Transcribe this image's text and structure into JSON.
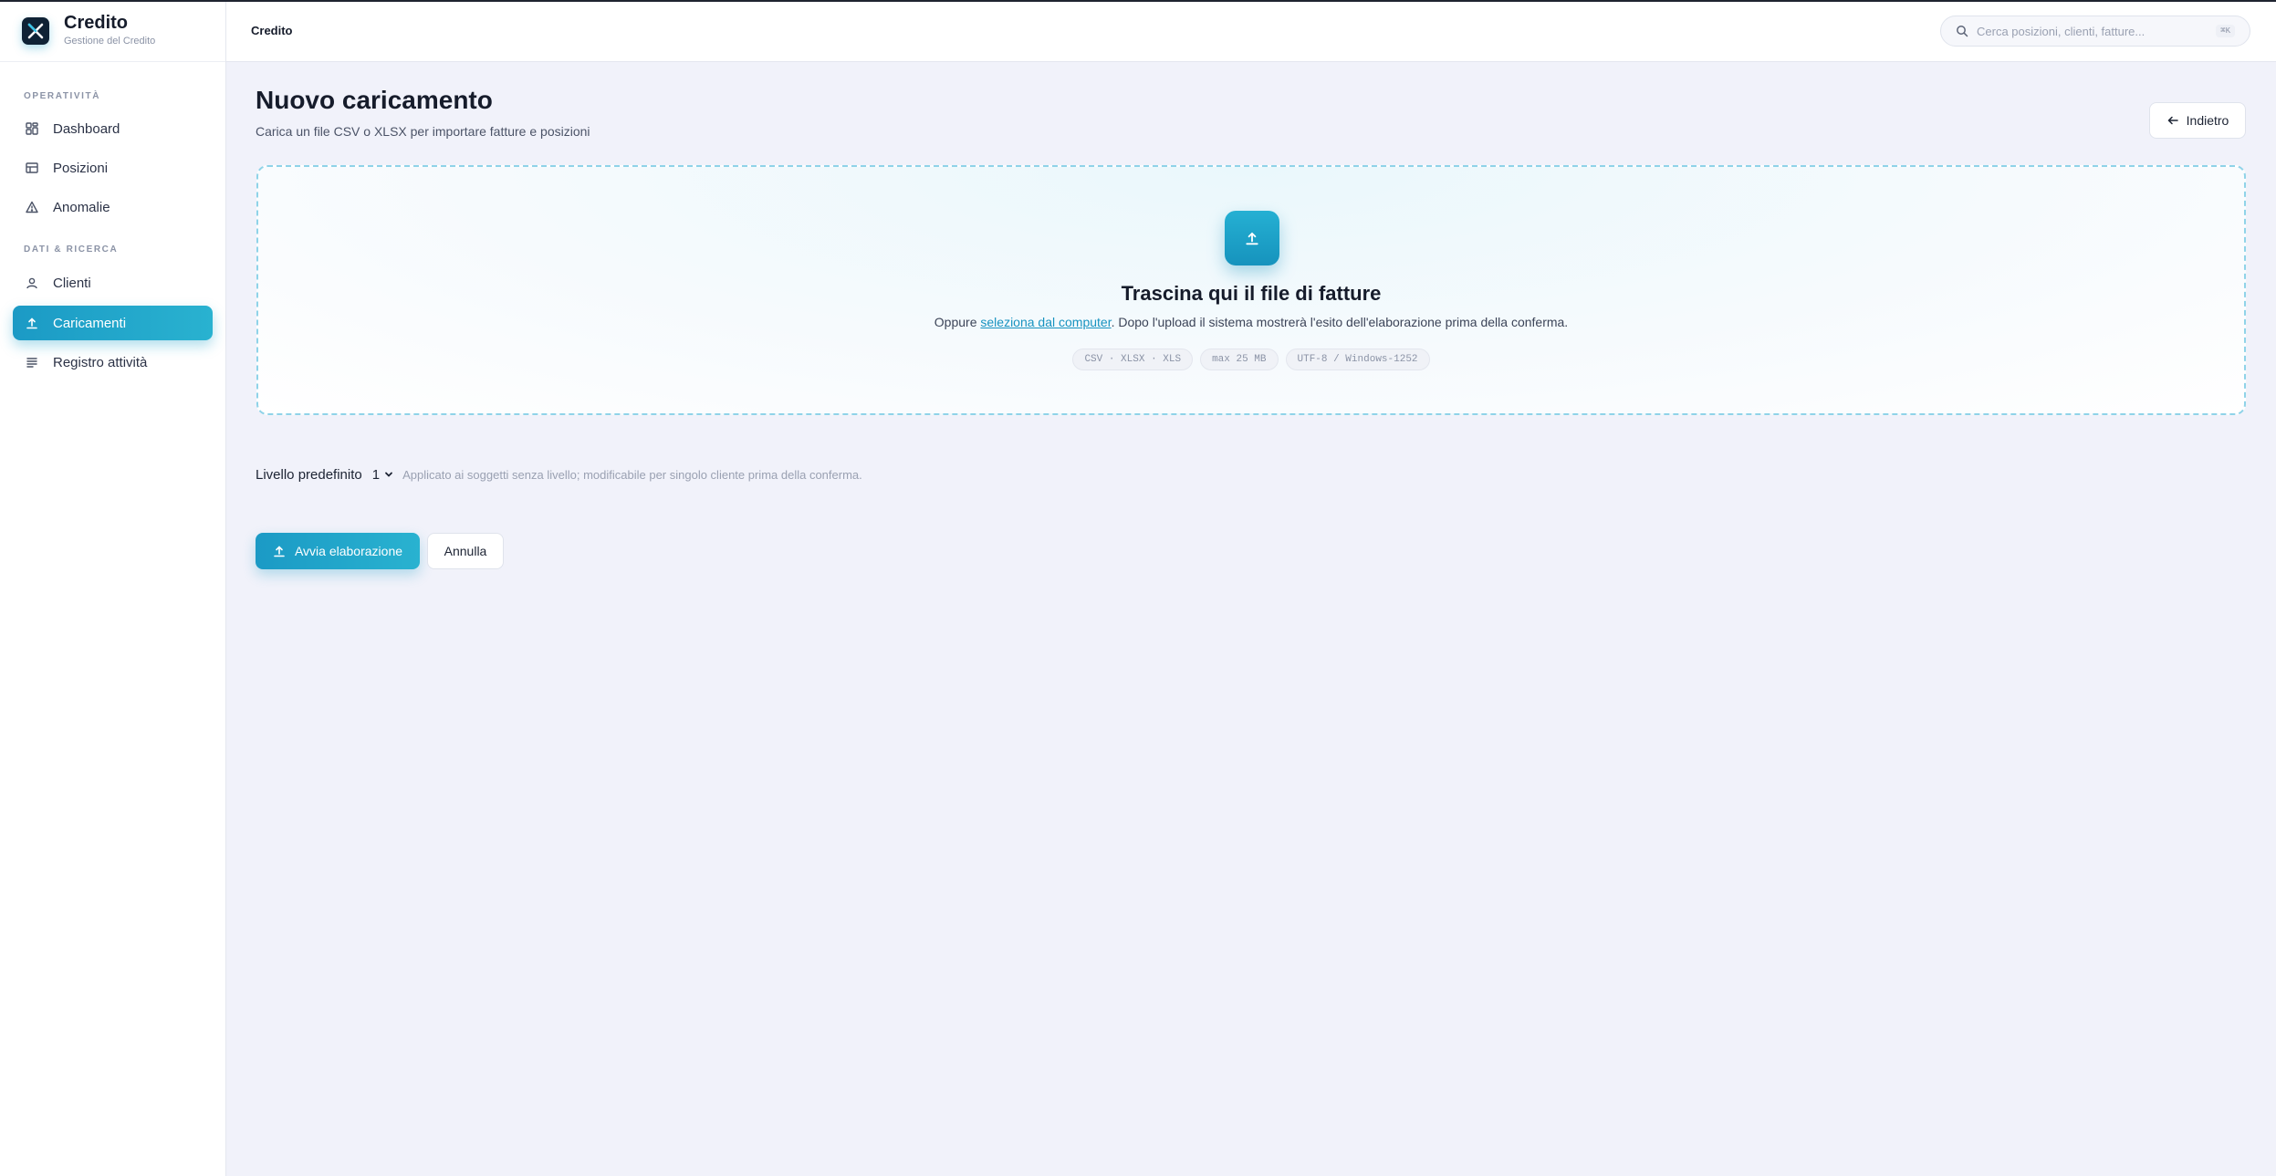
{
  "app": {
    "name": "Credito",
    "subtitle": "Gestione del Credito",
    "logo_icon": "x-logo-icon",
    "accent_color": "#1b9ac5"
  },
  "sidebar": {
    "sections": [
      {
        "label": "OPERATIVITÀ",
        "items": [
          {
            "label": "Dashboard",
            "icon": "grid-icon",
            "active": false
          },
          {
            "label": "Posizioni",
            "icon": "table-icon",
            "active": false
          },
          {
            "label": "Anomalie",
            "icon": "warning-icon",
            "active": false
          }
        ]
      },
      {
        "label": "DATI & RICERCA",
        "items": [
          {
            "label": "Clienti",
            "icon": "user-icon",
            "active": false
          },
          {
            "label": "Caricamenti",
            "icon": "upload-icon",
            "active": true
          },
          {
            "label": "Registro attività",
            "icon": "list-icon",
            "active": false
          }
        ]
      }
    ]
  },
  "header": {
    "breadcrumb": "Credito",
    "search_placeholder": "Cerca posizioni, clienti, fatture...",
    "search_shortcut": "⌘K"
  },
  "page": {
    "title": "Nuovo caricamento",
    "subtitle": "Carica un file CSV o XLSX per importare fatture e posizioni",
    "back_label": "Indietro"
  },
  "dropzone": {
    "title": "Trascina qui il file di fatture",
    "text_prefix": "Oppure ",
    "link_label": "seleziona dal computer",
    "text_suffix": ". Dopo l'upload il sistema mostrerà l'esito dell'elaborazione prima della conferma.",
    "chips": [
      "CSV · XLSX · XLS",
      "max 25 MB",
      "UTF-8 / Windows-1252"
    ]
  },
  "level": {
    "label": "Livello predefinito",
    "selected": "1",
    "help": "Applicato ai soggetti senza livello; modificabile per singolo cliente prima della conferma."
  },
  "actions": {
    "primary_label": "Avvia elaborazione",
    "secondary_label": "Annulla"
  }
}
